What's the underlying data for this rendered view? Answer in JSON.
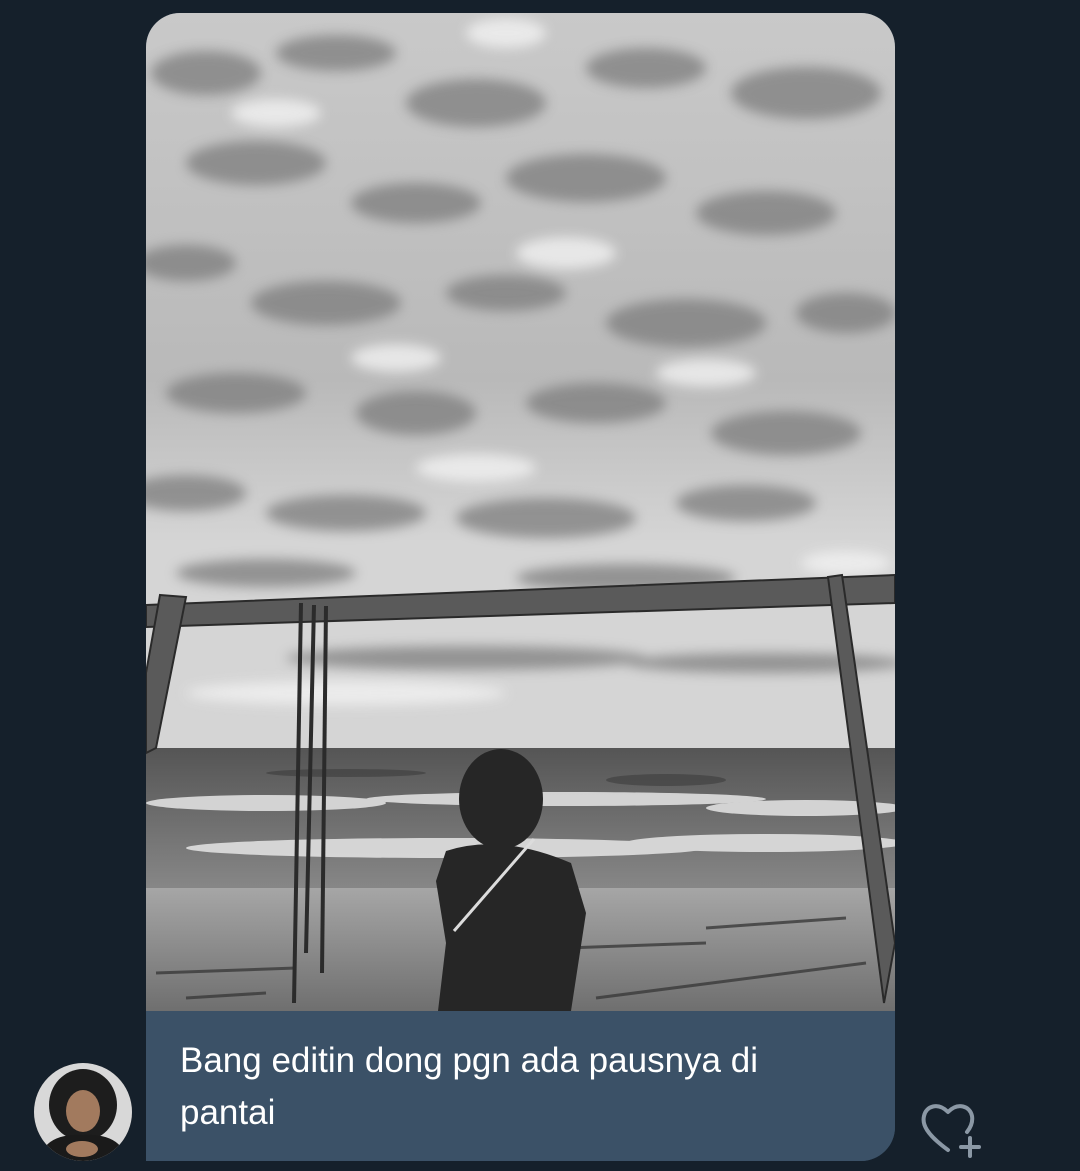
{
  "message": {
    "caption_line_1": "Bang editin dong pgn ada pausnya di",
    "caption_line_2": "pantai",
    "photo_icon": "beach-swing-photo",
    "avatar_icon": "sender-avatar",
    "reaction_icon": "heart-add-icon"
  },
  "colors": {
    "background": "#15202b",
    "bubble": "#3b5167",
    "text": "#ffffff",
    "icon": "#8b98a5"
  }
}
